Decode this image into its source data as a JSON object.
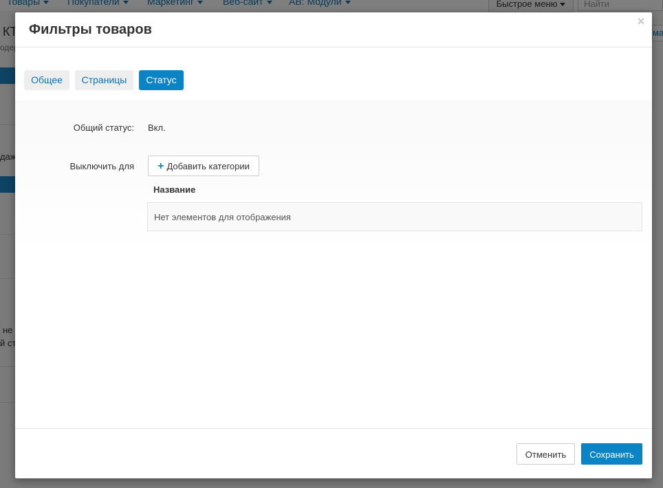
{
  "background": {
    "nav": [
      {
        "label": "Товары"
      },
      {
        "label": "Покупатели"
      },
      {
        "label": "Маркетинг"
      },
      {
        "label": "Веб-сайт"
      },
      {
        "label": "AB: Модули"
      }
    ],
    "quick_menu_label": "Быстрое меню",
    "search_placeholder": "Найти",
    "left_fragments": [
      "КТ",
      "одер",
      "даж",
      "не",
      "й стр"
    ],
    "right_fragment": "ма"
  },
  "modal": {
    "title": "Фильтры товаров",
    "close_glyph": "×",
    "tabs": [
      {
        "label": "Общее",
        "active": false
      },
      {
        "label": "Страницы",
        "active": false
      },
      {
        "label": "Статус",
        "active": true
      }
    ],
    "status": {
      "label": "Общий статус:",
      "value": "Вкл."
    },
    "disable_for": {
      "label": "Выключить для",
      "add_button_label": "Добавить категории",
      "table_header": "Название",
      "empty_text": "Нет элементов для отображения"
    },
    "footer": {
      "cancel_label": "Отменить",
      "save_label": "Сохранить"
    }
  },
  "colors": {
    "accent": "#0b84c6",
    "link": "#0b72b5",
    "tab_inactive_bg": "#eeeeee",
    "overlay": "rgba(0,0,0,0.5)"
  },
  "icons": {
    "add": "plus-icon",
    "close": "close-icon",
    "dropdown": "caret-down-icon"
  }
}
